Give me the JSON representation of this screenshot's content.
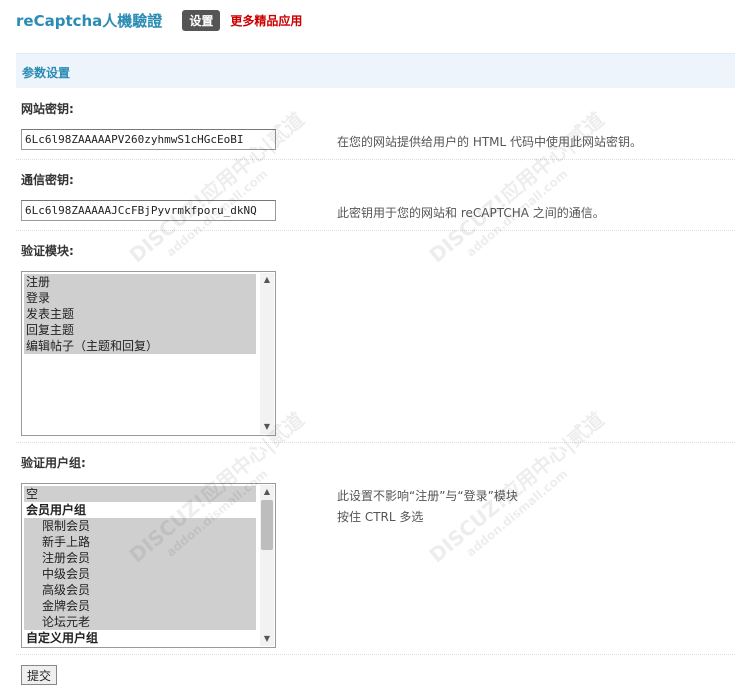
{
  "header": {
    "app_title": "reCaptcha人機驗證",
    "active_tab": "设置",
    "more_link": "更多精品应用"
  },
  "section": {
    "title": "参数设置"
  },
  "site_key": {
    "label": "网站密钥:",
    "value": "6Lc6l98ZAAAAAPV260zyhmwS1cHGcEoBI",
    "hint": "在您的网站提供给用户的 HTML 代码中使用此网站密钥。"
  },
  "secret_key": {
    "label": "通信密钥:",
    "value": "6Lc6l98ZAAAAAJCcFBjPyvrmkfporu_dkNQ",
    "hint": "此密钥用于您的网站和 reCAPTCHA 之间的通信。"
  },
  "modules": {
    "label": "验证模块:",
    "options": [
      {
        "label": "注册",
        "selected": true
      },
      {
        "label": "登录",
        "selected": true
      },
      {
        "label": "发表主题",
        "selected": true
      },
      {
        "label": "回复主题",
        "selected": true
      },
      {
        "label": "编辑帖子（主题和回复）",
        "selected": true
      }
    ]
  },
  "groups": {
    "label": "验证用户组:",
    "hint_1": "此设置不影响“注册”与“登录”模块",
    "hint_2": "按住 CTRL 多选",
    "options": [
      {
        "label": "空",
        "kind": "item",
        "selected": true
      },
      {
        "label": "会员用户组",
        "kind": "group",
        "selected": false
      },
      {
        "label": "限制会员",
        "kind": "child",
        "selected": true
      },
      {
        "label": "新手上路",
        "kind": "child",
        "selected": true
      },
      {
        "label": "注册会员",
        "kind": "child",
        "selected": true
      },
      {
        "label": "中级会员",
        "kind": "child",
        "selected": true
      },
      {
        "label": "高级会员",
        "kind": "child",
        "selected": true
      },
      {
        "label": "金牌会员",
        "kind": "child",
        "selected": true
      },
      {
        "label": "论坛元老",
        "kind": "child",
        "selected": true
      },
      {
        "label": "自定义用户组",
        "kind": "group",
        "selected": false
      }
    ]
  },
  "submit_label": "提交",
  "watermark": {
    "main": "DISCUZ!应用中心|贰道",
    "sub": "addon.dismall.com"
  },
  "colors": {
    "accent": "#2a8bb3",
    "link_red": "#cc0000",
    "header_bg": "#edf4fb",
    "selected_bg": "#cfcfcf"
  }
}
